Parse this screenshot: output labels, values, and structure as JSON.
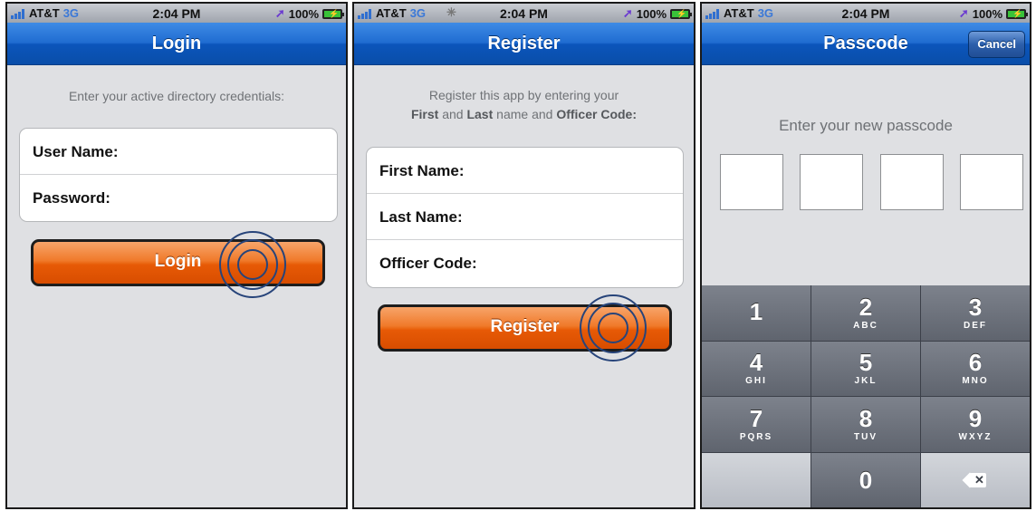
{
  "status_bar": {
    "carrier": "AT&T",
    "network": "3G",
    "time": "2:04 PM",
    "battery": "100%"
  },
  "screens": {
    "login": {
      "title": "Login",
      "hint": "Enter your active directory credentials:",
      "fields": [
        {
          "label": "User Name:"
        },
        {
          "label": "Password:"
        }
      ],
      "button": "Login"
    },
    "register": {
      "title": "Register",
      "hint_line1": "Register this app by entering your",
      "hint_first": "First",
      "hint_and": "and",
      "hint_last": "Last",
      "hint_name_and": "name and",
      "hint_code": "Officer Code:",
      "fields": [
        {
          "label": "First Name:"
        },
        {
          "label": "Last Name:"
        },
        {
          "label": "Officer Code:"
        }
      ],
      "button": "Register"
    },
    "passcode": {
      "title": "Passcode",
      "cancel": "Cancel",
      "prompt": "Enter your new passcode",
      "keys": [
        {
          "num": "1",
          "letters": ""
        },
        {
          "num": "2",
          "letters": "ABC"
        },
        {
          "num": "3",
          "letters": "DEF"
        },
        {
          "num": "4",
          "letters": "GHI"
        },
        {
          "num": "5",
          "letters": "JKL"
        },
        {
          "num": "6",
          "letters": "MNO"
        },
        {
          "num": "7",
          "letters": "PQRS"
        },
        {
          "num": "8",
          "letters": "TUV"
        },
        {
          "num": "9",
          "letters": "WXYZ"
        },
        {
          "num": "0",
          "letters": ""
        }
      ]
    }
  },
  "colors": {
    "nav_blue": "#1f6cd1",
    "button_orange": "#e75a06",
    "tap_ring": "#27447a"
  }
}
